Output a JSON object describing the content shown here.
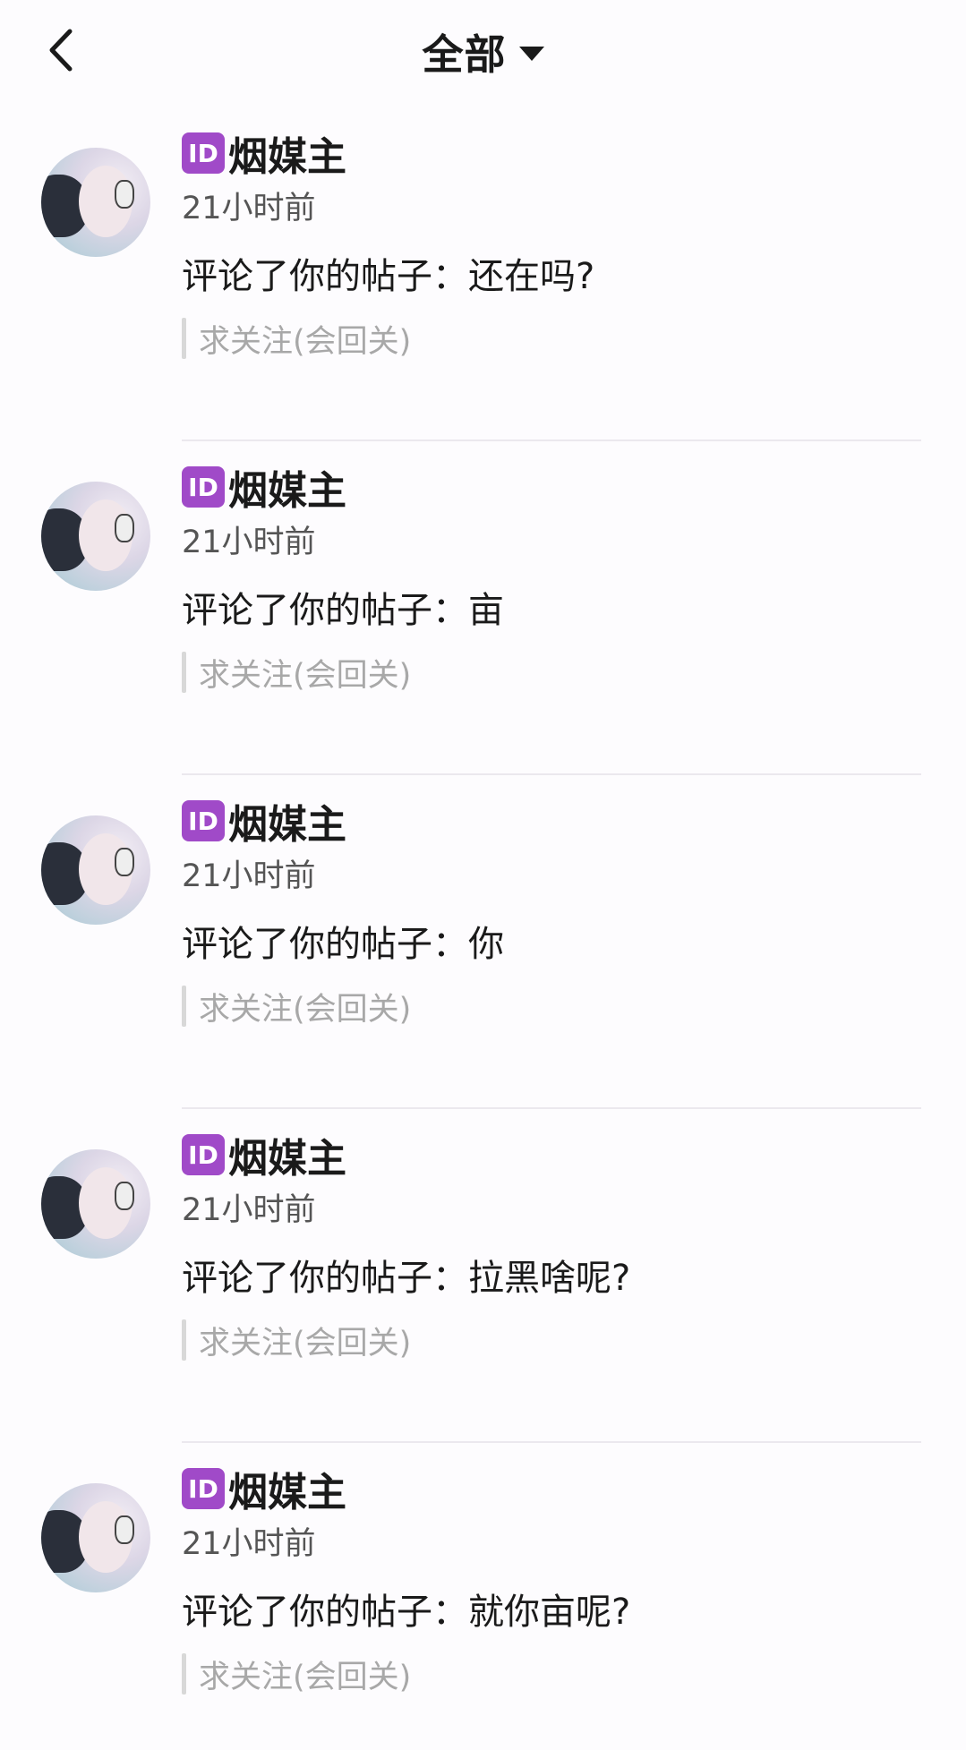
{
  "header": {
    "back_icon": "chevron-left-icon",
    "title": "全部",
    "title_icon": "caret-down-icon"
  },
  "notifications": [
    {
      "badge": "ID",
      "name": "烟媒主",
      "time": "21小时前",
      "comment": "评论了你的帖子：还在吗?",
      "quote": "求关注(会回关)"
    },
    {
      "badge": "ID",
      "name": "烟媒主",
      "time": "21小时前",
      "comment": "评论了你的帖子：亩",
      "quote": "求关注(会回关)"
    },
    {
      "badge": "ID",
      "name": "烟媒主",
      "time": "21小时前",
      "comment": "评论了你的帖子：你",
      "quote": "求关注(会回关)"
    },
    {
      "badge": "ID",
      "name": "烟媒主",
      "time": "21小时前",
      "comment": "评论了你的帖子：拉黑啥呢?",
      "quote": "求关注(会回关)"
    },
    {
      "badge": "ID",
      "name": "烟媒主",
      "time": "21小时前",
      "comment": "评论了你的帖子：就你亩呢?",
      "quote": "求关注(会回关)"
    }
  ],
  "colors": {
    "badge_bg": "#a04ac8",
    "quote_text": "#a8a8a8",
    "time_text": "#555555"
  }
}
